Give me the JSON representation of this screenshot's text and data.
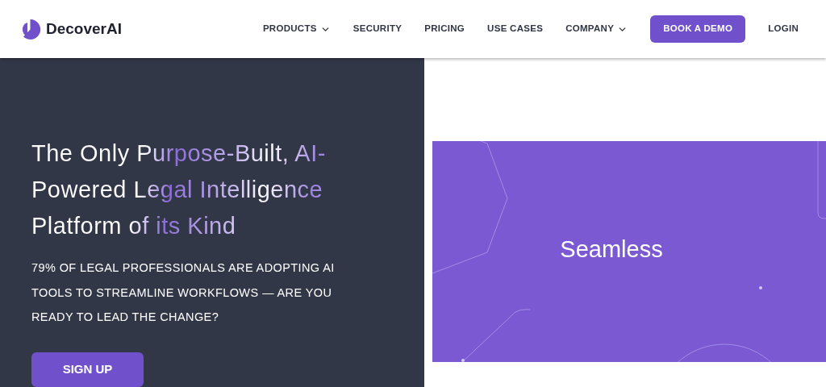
{
  "brand": {
    "name": "DecoverAI"
  },
  "nav": [
    {
      "label": "PRODUCTS",
      "kind": "dropdown"
    },
    {
      "label": "SECURITY",
      "kind": "link"
    },
    {
      "label": "PRICING",
      "kind": "link"
    },
    {
      "label": "USE CASES",
      "kind": "link"
    },
    {
      "label": "COMPANY",
      "kind": "dropdown"
    },
    {
      "label": "BOOK A DEMO",
      "kind": "button"
    },
    {
      "label": "LOGIN",
      "kind": "link"
    }
  ],
  "hero": {
    "heading": "The Only Purpose-Built, AI-Powered Legal Intelligence Platform of its Kind",
    "subheading": "79% OF LEGAL PROFESSIONALS ARE ADOPTING AI TOOLS TO STREAMLINE WORKFLOWS — ARE YOU READY TO LEAD THE CHANGE?",
    "cta": "SIGN UP"
  },
  "banner": {
    "text": "Seamless"
  }
}
